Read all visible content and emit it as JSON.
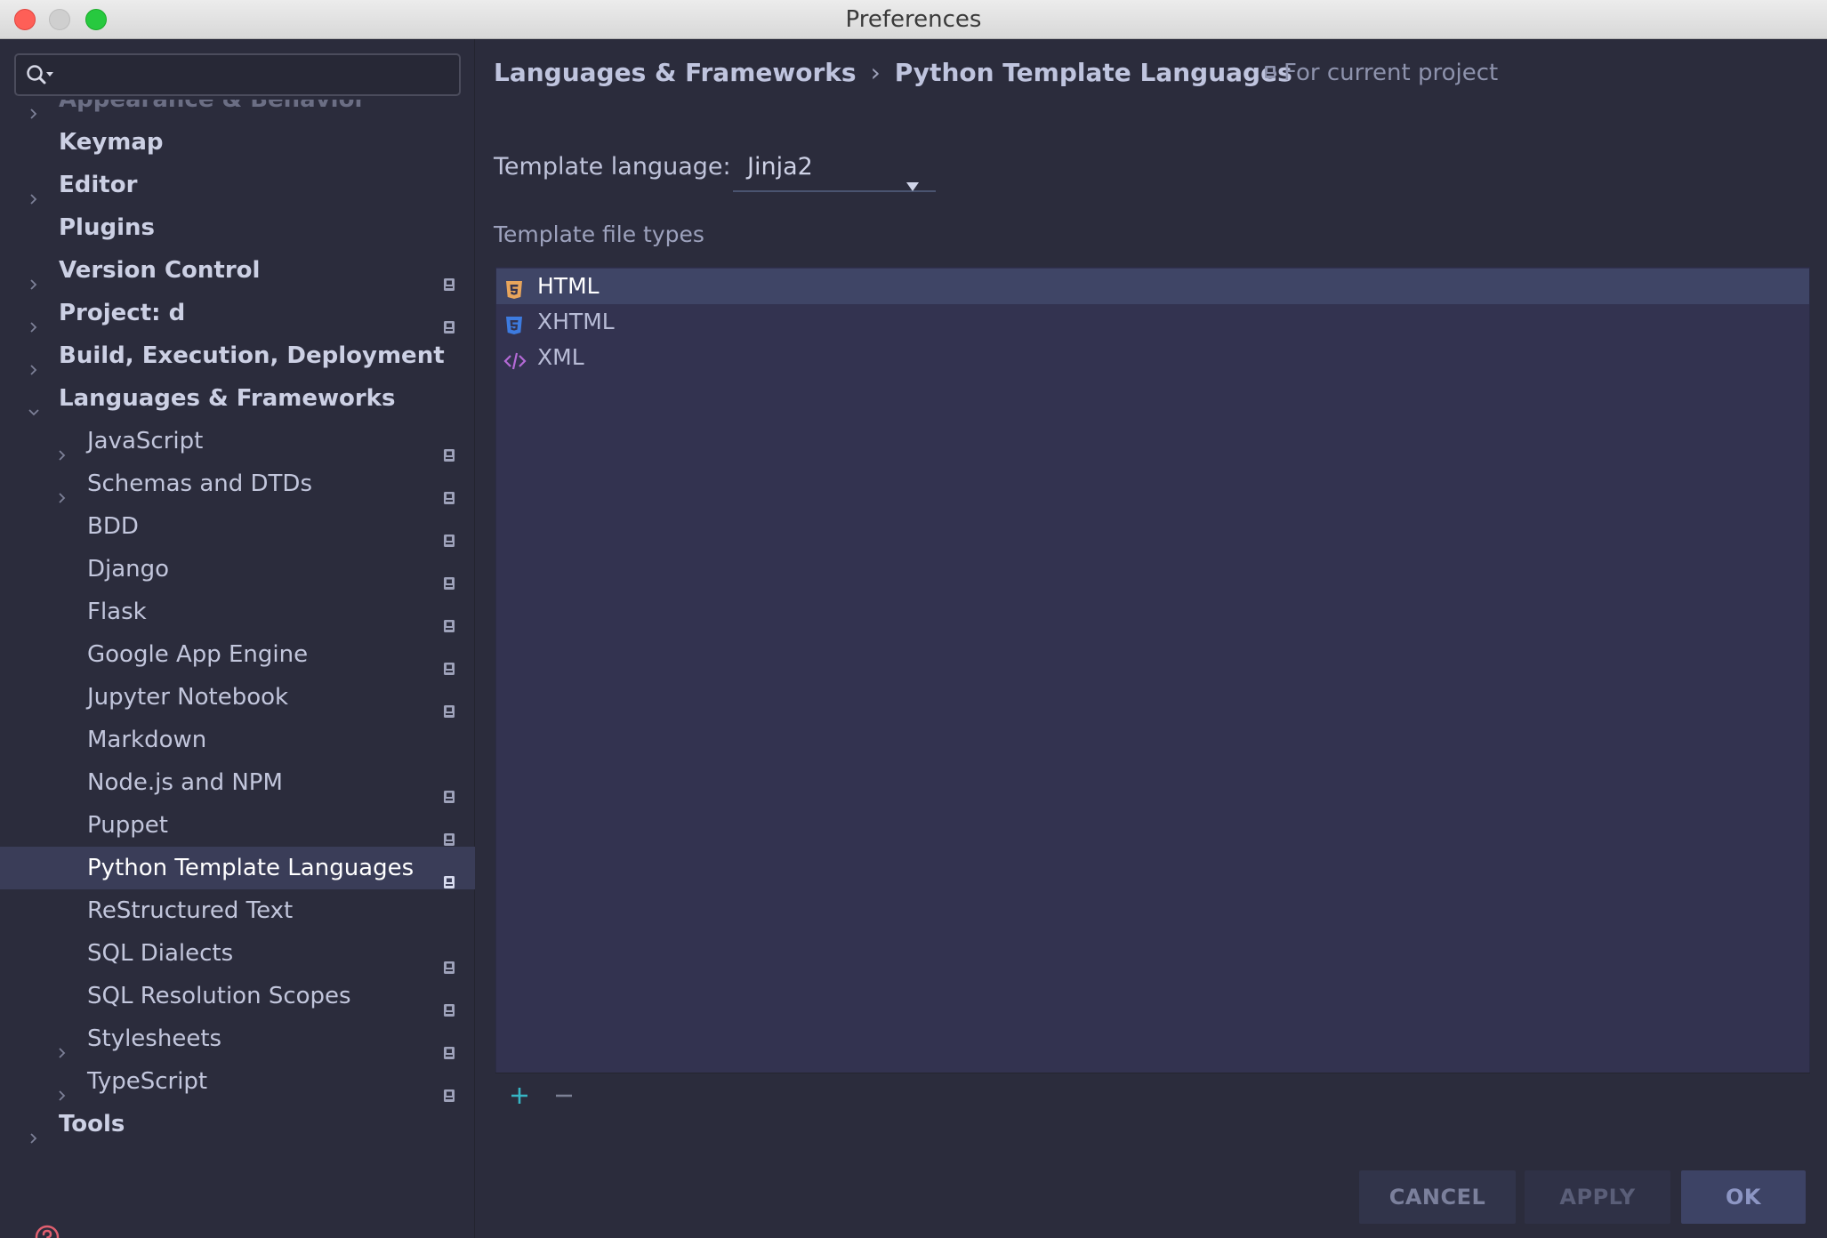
{
  "window": {
    "title": "Preferences"
  },
  "search": {
    "value": "",
    "placeholder": ""
  },
  "tree": [
    {
      "label": "Appearance & Behavior",
      "level": 0,
      "arrow": "right",
      "bold": true,
      "project": false,
      "faded": true
    },
    {
      "label": "Keymap",
      "level": 0,
      "arrow": "none",
      "bold": true,
      "project": false
    },
    {
      "label": "Editor",
      "level": 0,
      "arrow": "right",
      "bold": true,
      "project": false
    },
    {
      "label": "Plugins",
      "level": 0,
      "arrow": "none",
      "bold": true,
      "project": false
    },
    {
      "label": "Version Control",
      "level": 0,
      "arrow": "right",
      "bold": true,
      "project": true
    },
    {
      "label": "Project: d",
      "level": 0,
      "arrow": "right",
      "bold": true,
      "project": true
    },
    {
      "label": "Build, Execution, Deployment",
      "level": 0,
      "arrow": "right",
      "bold": true,
      "project": false
    },
    {
      "label": "Languages & Frameworks",
      "level": 0,
      "arrow": "down",
      "bold": true,
      "project": false
    },
    {
      "label": "JavaScript",
      "level": 1,
      "arrow": "right",
      "bold": false,
      "project": true
    },
    {
      "label": "Schemas and DTDs",
      "level": 1,
      "arrow": "right",
      "bold": false,
      "project": true
    },
    {
      "label": "BDD",
      "level": 1,
      "arrow": "none",
      "bold": false,
      "project": true
    },
    {
      "label": "Django",
      "level": 1,
      "arrow": "none",
      "bold": false,
      "project": true
    },
    {
      "label": "Flask",
      "level": 1,
      "arrow": "none",
      "bold": false,
      "project": true
    },
    {
      "label": "Google App Engine",
      "level": 1,
      "arrow": "none",
      "bold": false,
      "project": true
    },
    {
      "label": "Jupyter Notebook",
      "level": 1,
      "arrow": "none",
      "bold": false,
      "project": true
    },
    {
      "label": "Markdown",
      "level": 1,
      "arrow": "none",
      "bold": false,
      "project": false
    },
    {
      "label": "Node.js and NPM",
      "level": 1,
      "arrow": "none",
      "bold": false,
      "project": true
    },
    {
      "label": "Puppet",
      "level": 1,
      "arrow": "none",
      "bold": false,
      "project": true
    },
    {
      "label": "Python Template Languages",
      "level": 1,
      "arrow": "none",
      "bold": false,
      "project": true,
      "selected": true
    },
    {
      "label": "ReStructured Text",
      "level": 1,
      "arrow": "none",
      "bold": false,
      "project": false
    },
    {
      "label": "SQL Dialects",
      "level": 1,
      "arrow": "none",
      "bold": false,
      "project": true
    },
    {
      "label": "SQL Resolution Scopes",
      "level": 1,
      "arrow": "none",
      "bold": false,
      "project": true
    },
    {
      "label": "Stylesheets",
      "level": 1,
      "arrow": "right",
      "bold": false,
      "project": true
    },
    {
      "label": "TypeScript",
      "level": 1,
      "arrow": "right",
      "bold": false,
      "project": true
    },
    {
      "label": "Tools",
      "level": 0,
      "arrow": "right",
      "bold": true,
      "project": false
    }
  ],
  "breadcrumb": {
    "parent": "Languages & Frameworks",
    "separator": "›",
    "current": "Python Template Languages"
  },
  "scope_note": "For current project",
  "template_language": {
    "label": "Template language:",
    "value": "Jinja2"
  },
  "file_types": {
    "label": "Template file types",
    "items": [
      {
        "label": "HTML",
        "icon": "html5-icon",
        "color": "#e8a55c",
        "selected": true
      },
      {
        "label": "XHTML",
        "icon": "css3-icon",
        "color": "#3d7be0",
        "selected": false
      },
      {
        "label": "XML",
        "icon": "code-tag-icon",
        "color": "#b46ad6",
        "selected": false
      }
    ]
  },
  "buttons": {
    "cancel": "CANCEL",
    "apply": "APPLY",
    "ok": "OK"
  },
  "colors": {
    "accent_add": "#36b5c4",
    "selection": "#3a3d58"
  }
}
